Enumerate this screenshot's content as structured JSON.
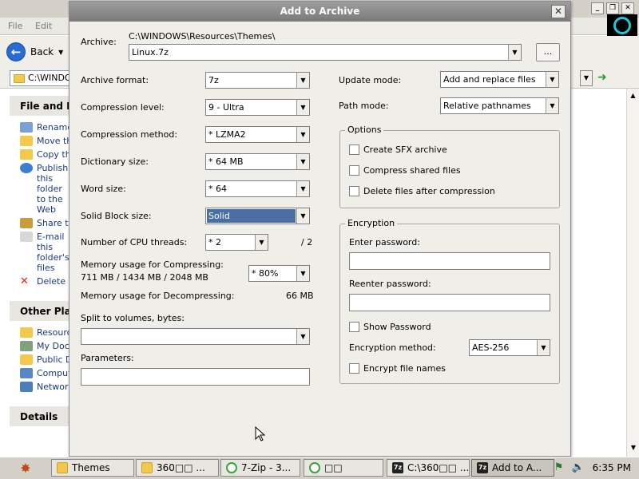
{
  "explorer": {
    "menu": [
      "File",
      "Edit"
    ],
    "back_label": "Back",
    "address": "C:\\WINDOWS\\Resources\\Themes",
    "panels": [
      {
        "title": "File and Folder Tasks",
        "items": [
          {
            "label": "Rename this folder",
            "icon": "rename-icon"
          },
          {
            "label": "Move this folder",
            "icon": "move-icon"
          },
          {
            "label": "Copy this folder",
            "icon": "copy-icon"
          },
          {
            "label": "Publish this folder to the Web",
            "icon": "globe-icon"
          },
          {
            "label": "Share this folder",
            "icon": "share-icon"
          },
          {
            "label": "E-mail this folder's files",
            "icon": "email-icon"
          },
          {
            "label": "Delete this folder",
            "icon": "delete-icon"
          }
        ]
      },
      {
        "title": "Other Places",
        "items": [
          {
            "label": "Resources",
            "icon": "folder-icon"
          },
          {
            "label": "My Documents",
            "icon": "documents-icon"
          },
          {
            "label": "Public Documents",
            "icon": "folder-icon"
          },
          {
            "label": "Computer",
            "icon": "computer-icon"
          },
          {
            "label": "Network",
            "icon": "network-icon"
          }
        ]
      },
      {
        "title": "Details",
        "items": []
      }
    ]
  },
  "dialog": {
    "title": "Add to Archive",
    "archive_label": "Archive:",
    "archive_path": "C:\\WINDOWS\\Resources\\Themes\\",
    "archive_name": "Linux.7z",
    "browse_label": "...",
    "format_label": "Archive format:",
    "format_value": "7z",
    "level_label": "Compression level:",
    "level_value": "9 - Ultra",
    "method_label": "Compression method:",
    "method_value": "* LZMA2",
    "dict_label": "Dictionary size:",
    "dict_value": "* 64 MB",
    "word_label": "Word size:",
    "word_value": "* 64",
    "solid_label": "Solid Block size:",
    "solid_value": "Solid",
    "threads_label": "Number of CPU threads:",
    "threads_value": "* 2",
    "threads_max": "/ 2",
    "mem_comp_label": "Memory usage for Compressing:",
    "mem_comp_value": "711 MB / 1434 MB / 2048 MB",
    "mem_comp_pct": "* 80%",
    "mem_decomp_label": "Memory usage for Decompressing:",
    "mem_decomp_value": "66 MB",
    "split_label": "Split to volumes, bytes:",
    "split_value": "",
    "params_label": "Parameters:",
    "params_value": "",
    "update_label": "Update mode:",
    "update_value": "Add and replace files",
    "path_label": "Path mode:",
    "path_value": "Relative pathnames",
    "options_title": "Options",
    "opt_sfx": "Create SFX archive",
    "opt_shared": "Compress shared files",
    "opt_delete": "Delete files after compression",
    "enc_title": "Encryption",
    "enc_password_label": "Enter password:",
    "enc_reenter_label": "Reenter password:",
    "enc_show": "Show Password",
    "enc_method_label": "Encryption method:",
    "enc_method_value": "AES-256",
    "enc_filenames": "Encrypt file names"
  },
  "taskbar": {
    "items": [
      {
        "label": "Themes",
        "icon": "folder"
      },
      {
        "label": "360□□ ...",
        "icon": "folder"
      },
      {
        "label": "7-Zip - 3...",
        "icon": "ie"
      },
      {
        "label": "□□",
        "icon": "ie"
      },
      {
        "label": "C:\\360□□ ...",
        "icon": "zip"
      },
      {
        "label": "Add to A...",
        "icon": "zip"
      }
    ],
    "time": "6:35 PM"
  }
}
